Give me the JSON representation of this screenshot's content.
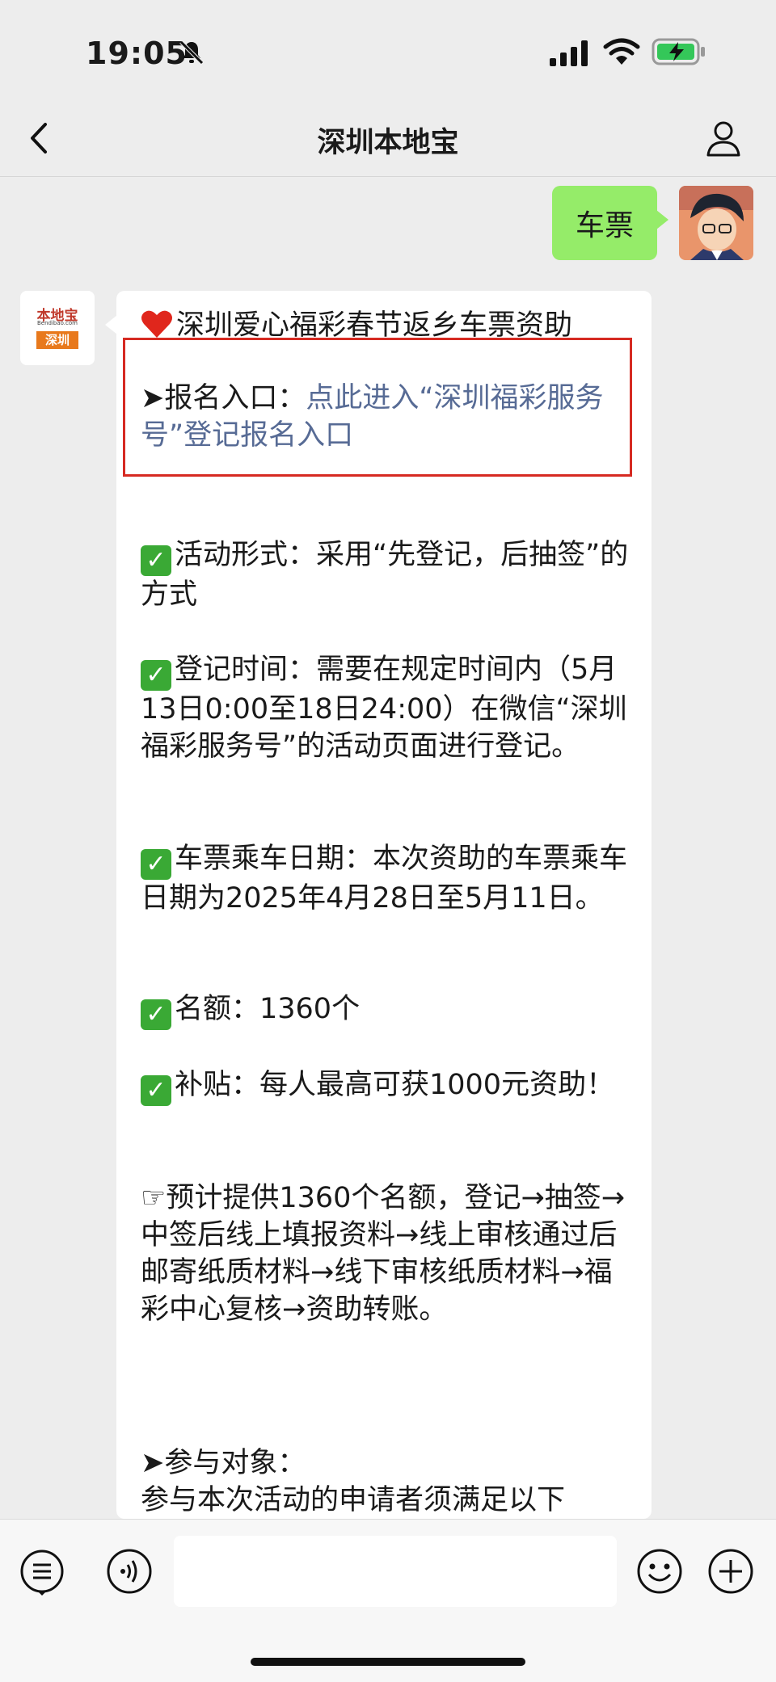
{
  "status_bar": {
    "time": "19:05"
  },
  "nav": {
    "title": "深圳本地宝"
  },
  "chat": {
    "outgoing": {
      "text": "车票"
    },
    "bot_logo": {
      "line1": "本地宝",
      "line2": "Bendibao.com",
      "tag": "深圳"
    },
    "message": {
      "title": "深圳爱心福彩春节返乡车票资助",
      "signup_label": "➤报名入口：",
      "signup_link": "点此进入“深圳福彩服务号”登记报名入口",
      "form_text": "活动形式：采用“先登记，后抽签”的方式",
      "time_text": "登记时间：需要在规定时间内（5月13日0:00至18日24:00）在微信“深圳福彩服务号”的活动页面进行登记。",
      "ride_text": "车票乘车日期：本次资助的车票乘车日期为2025年4月28日至5月11日。",
      "quota_text": "名额：1360个",
      "subsidy_text": "补贴：每人最高可获1000元资助！",
      "process_text": "☞预计提供1360个名额，登记→抽签→中签后线上填报资料→线上审核通过后邮寄纸质材料→线下审核纸质材料→福彩中心复核→资助转账。",
      "target_heading": "➤参与对象：",
      "target_text": "参与本次活动的申请者须满足以下"
    }
  },
  "colors": {
    "bubble_green": "#95ec69",
    "link": "#576b95",
    "highlight": "#d62a22",
    "check": "#3aa935"
  }
}
